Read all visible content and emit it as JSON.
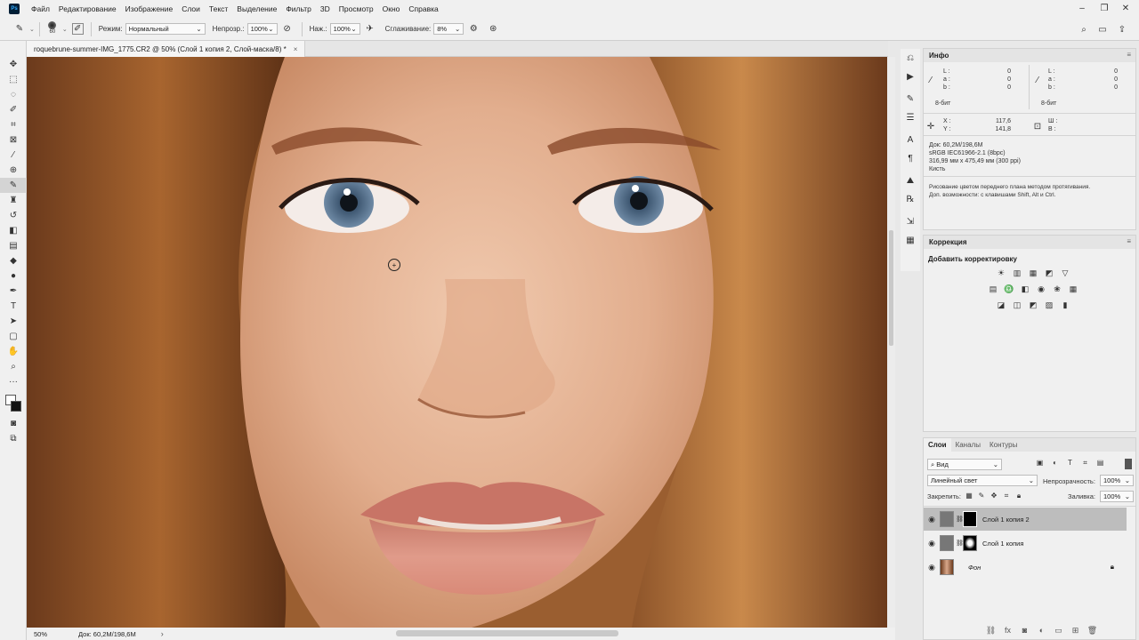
{
  "menu": {
    "logo": "Ps",
    "items": [
      "Файл",
      "Редактирование",
      "Изображение",
      "Слои",
      "Текст",
      "Выделение",
      "Фильтр",
      "3D",
      "Просмотр",
      "Окно",
      "Справка"
    ]
  },
  "options": {
    "brush_size": "60",
    "mode_label": "Режим:",
    "mode_value": "Нормальный",
    "opacity_label": "Непрозр.:",
    "opacity_value": "100%",
    "pressure_label": "Наж.:",
    "pressure_value": "100%",
    "smoothing_label": "Сглаживание:",
    "smoothing_value": "8%"
  },
  "document": {
    "tab_title": "roquebrune-summer-IMG_1775.CR2 @ 50% (Слой 1 копия 2, Слой-маска/8) *",
    "close": "×"
  },
  "status": {
    "zoom": "50%",
    "doc": "Док: 60,2M/198,6M",
    "arrow": "›"
  },
  "info_panel": {
    "title": "Инфо",
    "lab_left": {
      "L": "0",
      "a": "0",
      "b": "0"
    },
    "lab_right": {
      "L": "0",
      "a": "0",
      "b": "0"
    },
    "bits_left": "8-бит",
    "bits_right": "8-бит",
    "x_label": "X :",
    "x_value": "117,6",
    "y_label": "Y :",
    "y_value": "141,8",
    "w_label": "Ш :",
    "h_label": "В :",
    "doc_size": "Док: 60,2M/198,6M",
    "profile": "sRGB IEC61966-2.1 (8bpc)",
    "dimensions": "316,99 мм x 475,49 мм (300 ppi)",
    "tool": "Кисть",
    "hint1": "Рисование цветом переднего плана методом протягивания.",
    "hint2": "Доп. возможности: с клавишами Shift, Alt и Ctrl."
  },
  "correction_panel": {
    "title": "Коррекция",
    "subtitle": "Добавить корректировку"
  },
  "layers_panel": {
    "tabs": [
      "Слои",
      "Каналы",
      "Контуры"
    ],
    "filter": "Вид",
    "blend_mode": "Линейный свет",
    "opacity_label": "Непрозрачность:",
    "opacity_value": "100%",
    "lock_label": "Закрепить:",
    "fill_label": "Заливка:",
    "fill_value": "100%",
    "layers": [
      {
        "name": "Слой 1 копия 2",
        "selected": true
      },
      {
        "name": "Слой 1 копия",
        "selected": false
      },
      {
        "name": "Фон",
        "selected": false
      }
    ]
  }
}
